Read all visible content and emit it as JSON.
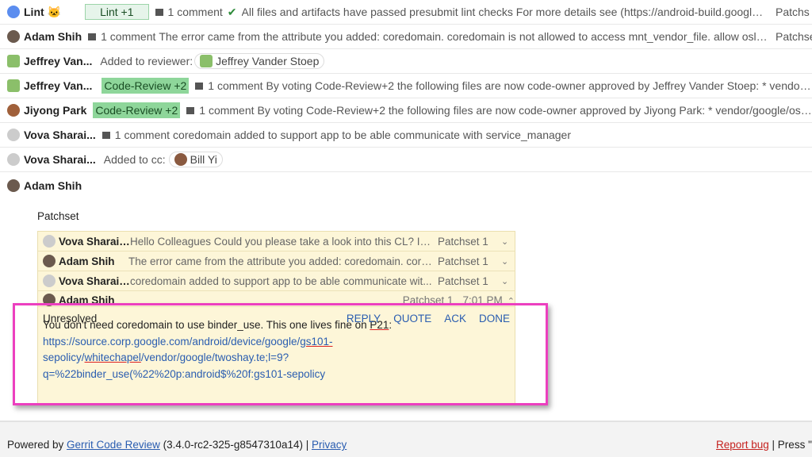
{
  "messages": [
    {
      "author": "Lint",
      "badge": "Lint +1",
      "comment_count": "1 comment",
      "text": "All files and artifacts have passed presubmit lint checks For more details see (https://android-build.googleplex.c...",
      "patchset": "Patchs"
    },
    {
      "author": "Adam Shih",
      "comment_count": "1 comment",
      "text": "The error came from the attribute you added: coredomain. coredomain is not allowed to access mnt_vendor_file. allow oslo_app ...",
      "patchset": "Patchse"
    },
    {
      "author": "Jeffrey Van...",
      "text": "Added to reviewer:",
      "reviewer": "Jeffrey Vander Stoep"
    },
    {
      "author": "Jeffrey Van...",
      "badge": "Code-Review +2",
      "comment_count": "1 comment",
      "text": "By voting Code-Review+2 the following files are now code-owner approved by Jeffrey Vander Stoep: * vendor/google/..."
    },
    {
      "author": "Jiyong Park",
      "badge": "Code-Review +2",
      "comment_count": "1 comment",
      "text": "By voting Code-Review+2 the following files are now code-owner approved by Jiyong Park: * vendor/google/oslo_app.te"
    },
    {
      "author": "Vova Sharai...",
      "comment_count": "1 comment",
      "text": "coredomain added to support app to be able communicate with service_manager"
    },
    {
      "author": "Vova Sharai...",
      "text": "Added to cc:",
      "cc": "Bill Yi"
    },
    {
      "author": "Adam Shih"
    }
  ],
  "thread": {
    "file": "Patchset",
    "comments": [
      {
        "author": "Vova Sharaie...",
        "text": "Hello Colleagues Could you please take a look into this CL? I d...",
        "patchset": "Patchset 1"
      },
      {
        "author": "Adam Shih",
        "text": "The error came from the attribute you added: coredomain. core...",
        "patchset": "Patchset 1"
      },
      {
        "author": "Vova Sharaie...",
        "text": "coredomain added to support app to be able communicate wit...",
        "patchset": "Patchset 1"
      }
    ],
    "expanded": {
      "author": "Adam Shih",
      "patchset": "Patchset 1",
      "time": "7:01 PM",
      "body_start": "You don't need coredomain to use binder_use. This one lives fine on ",
      "body_p21": "P21",
      "body_colon": ":",
      "link_1": "https://source.corp.google.com/android/device/google/",
      "link_2": "gs101-",
      "link_3": "sepolicy/",
      "link_4": "whitechapel",
      "link_5": "/vendor/google/twoshay.te;l=9?",
      "link_6": "q=%22binder_use(%22%20p:android$%20f:gs101-sepolicy",
      "status": "Unresolved",
      "reply": "REPLY",
      "quote": "QUOTE",
      "ack": "ACK",
      "done": "DONE"
    }
  },
  "footer": {
    "powered": "Powered by ",
    "gerrit": "Gerrit Code Review",
    "version": " (3.4.0-rc2-325-g8547310a14) | ",
    "privacy": "Privacy",
    "report": "Report bug",
    "press": " | Press \"?\""
  },
  "colors": {
    "highlight": "#ec3fbf",
    "vote_chip": "#8ed69a",
    "link": "#2a5db0"
  }
}
